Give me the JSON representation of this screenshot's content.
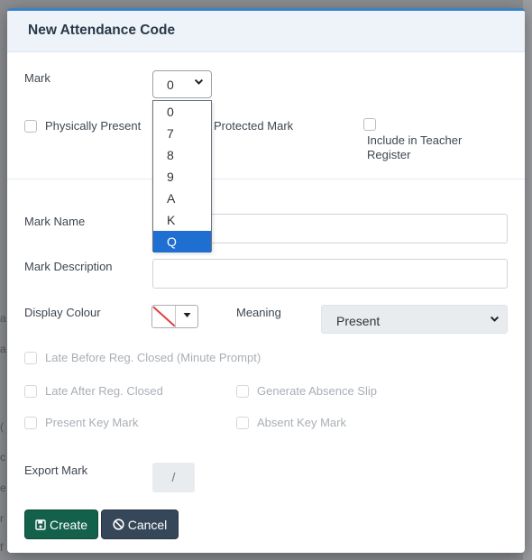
{
  "modal": {
    "title": "New Attendance Code"
  },
  "form": {
    "mark_label": "Mark",
    "mark_value": "0",
    "mark_options": [
      "0",
      "7",
      "8",
      "9",
      "A",
      "K",
      "Q"
    ],
    "mark_highlighted": "Q",
    "physically_present_label": "Physically Present",
    "protected_mark_label": "Protected Mark",
    "include_teacher_register_label_1": "Include in Teacher",
    "include_teacher_register_label_2": "Register",
    "mark_name_label": "Mark Name",
    "mark_name_value": "",
    "mark_description_label": "Mark Description",
    "mark_description_value": "",
    "display_colour_label": "Display Colour",
    "meaning_label": "Meaning",
    "meaning_value": "Present",
    "late_before_label": "Late Before Reg. Closed (Minute Prompt)",
    "late_after_label": "Late After Reg. Closed",
    "generate_absence_slip_label": "Generate Absence Slip",
    "present_key_mark_label": "Present Key Mark",
    "absent_key_mark_label": "Absent Key Mark",
    "export_mark_label": "Export Mark",
    "export_mark_value": "/"
  },
  "buttons": {
    "create_label": "Create",
    "cancel_label": "Cancel"
  },
  "background": {
    "fragments": [
      "a",
      "a",
      "(",
      "c",
      "e",
      "r",
      "f"
    ]
  },
  "colors": {
    "create_button": "#14614b",
    "cancel_button": "#36475a",
    "dropdown_highlight": "#1e6fd1",
    "header_background": "#eef3f9",
    "colour_swatch_line": "#e04040"
  },
  "icons": {
    "mark_select_chevron": "chevron-down-icon",
    "meaning_select_chevron": "chevron-down-icon",
    "colour_picker_arrow": "caret-down-icon",
    "create_button_icon": "floppy-disk-icon",
    "cancel_button_icon": "ban-icon"
  }
}
